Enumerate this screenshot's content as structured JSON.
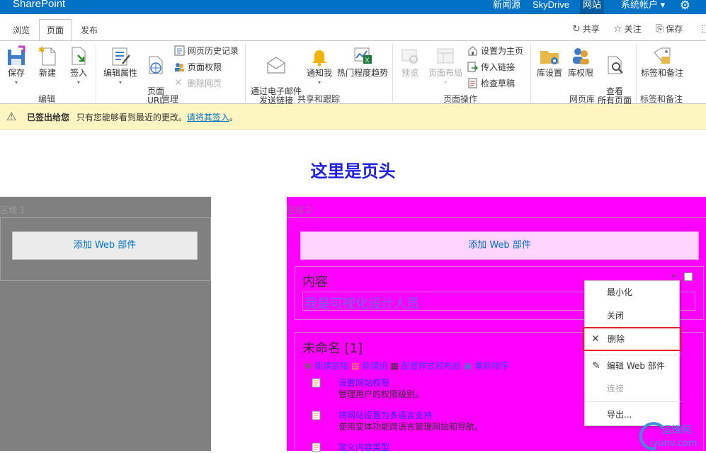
{
  "suitebar": {
    "brand": "SharePoint",
    "links": [
      "新闻源",
      "SkyDrive",
      "网站"
    ],
    "account": "系统帐户 ▾"
  },
  "tabs": {
    "items": [
      "浏览",
      "页面",
      "发布"
    ],
    "actions": [
      "共享",
      "关注",
      "保存"
    ]
  },
  "ribbon": {
    "edit": {
      "save": "保存",
      "new": "新建",
      "checkin": "签入",
      "label": "编辑"
    },
    "manage": {
      "edit_props": "编辑属性",
      "page_url": "页面\nURL",
      "history": "网页历史记录",
      "permissions": "页面权限",
      "delete": "删除网页",
      "label": "管理"
    },
    "share": {
      "email": "通过电子邮件\n发送链接",
      "alert": "通知我",
      "popularity": "热门程度趋势",
      "label": "共享和跟踪"
    },
    "page_actions": {
      "preview": "预览",
      "layout": "页面布局",
      "set_home": "设置为主页",
      "incoming": "传入链接",
      "check_draft": "检查草稿",
      "label": "页面操作"
    },
    "library": {
      "settings": "库设置",
      "permissions": "库权限",
      "view_all": "查看\n所有页面",
      "label": "网页库"
    },
    "tags": {
      "tags_notes": "标签和备注",
      "label": "标签和备注"
    }
  },
  "status": {
    "title": "已签出给您",
    "message": "只有您能够看到最近的更改。",
    "link": "请将其签入",
    "end": "。"
  },
  "page": {
    "header": "这里是页头",
    "zone1": {
      "label": "区域 1",
      "add_webpart": "添加 Web 部件"
    },
    "zone2": {
      "label": "区域 2",
      "add_webpart": "添加 Web 部件",
      "webpart1": {
        "title": "内容",
        "body": "我是可视化设计人员"
      },
      "webpart2": {
        "title": "未命名 [1]",
        "toolbar": [
          "新建链接",
          "新建组",
          "配置样式和布局",
          "重新排序"
        ],
        "items": [
          {
            "title": "设置网站权限",
            "desc": "管理用户的权限级别。"
          },
          {
            "title": "将网站设置为多语言支持",
            "desc": "使用变体功能跨语言管理网站和导航。"
          },
          {
            "title": "定义内容类型",
            "desc": ""
          }
        ]
      }
    }
  },
  "menu": {
    "items": [
      "最小化",
      "关闭",
      "删除",
      "编辑 Web 部件",
      "连接",
      "导出..."
    ]
  },
  "watermark": {
    "line1": "运维网",
    "line2": "iyunv.com"
  },
  "colors": {
    "suitebar": "#0072c6",
    "zone1": "#808080",
    "zone2": "#ff00ff",
    "header": "#1e1ee6",
    "highlight": "#e0202c"
  }
}
